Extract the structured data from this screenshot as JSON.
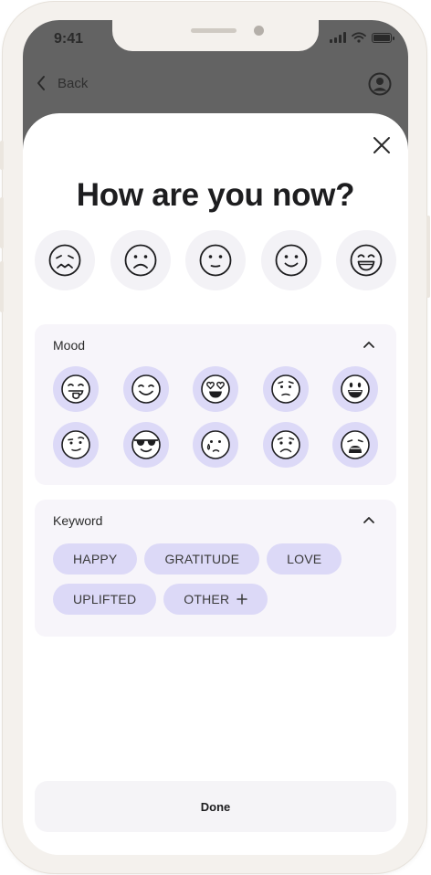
{
  "status_bar": {
    "time": "9:41"
  },
  "nav": {
    "back_label": "Back"
  },
  "sheet": {
    "title": "How are you now?",
    "quick_faces": [
      "distressed-face",
      "sad-face",
      "neutral-face",
      "slightly-smiling-face",
      "grinning-face"
    ],
    "mood": {
      "header": "Mood",
      "icons": [
        "tongue-out-face",
        "smiling-face",
        "heart-eyes-face",
        "worried-face",
        "grinning-face",
        "skeptical-face",
        "sunglasses-face",
        "crying-face",
        "anxious-face",
        "weary-face"
      ]
    },
    "keyword": {
      "header": "Keyword",
      "chips": [
        "HAPPY",
        "GRATITUDE",
        "LOVE",
        "UPLIFTED"
      ],
      "other_label": "OTHER",
      "other_icon": "plus-icon"
    },
    "done_label": "Done"
  },
  "colors": {
    "header_bg": "#636363",
    "accent_soft": "#dcd9f7",
    "card_bg": "#f7f5fa",
    "frame": "#f4f1ed"
  }
}
